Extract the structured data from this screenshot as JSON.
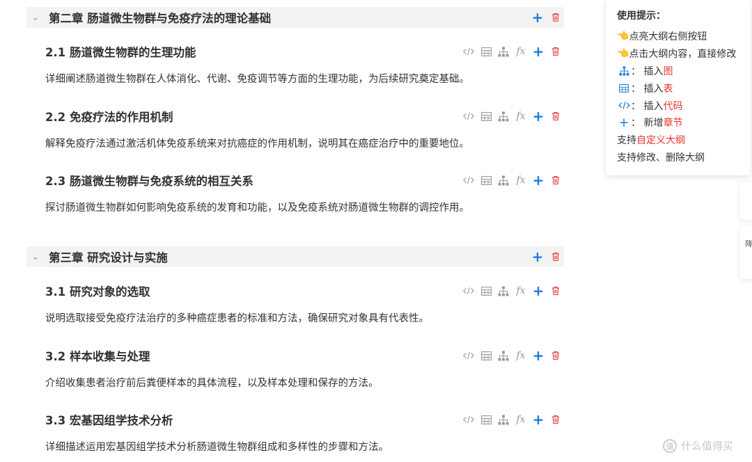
{
  "chapters": [
    {
      "title": "第二章 肠道微生物群与免疫疗法的理论基础",
      "sections": [
        {
          "title": "2.1 肠道微生物群的生理功能",
          "desc": "详细阐述肠道微生物群在人体消化、代谢、免疫调节等方面的生理功能，为后续研究奠定基础。"
        },
        {
          "title": "2.2 免疫疗法的作用机制",
          "desc": "解释免疫疗法通过激活机体免疫系统来对抗癌症的作用机制，说明其在癌症治疗中的重要地位。"
        },
        {
          "title": "2.3 肠道微生物群与免疫系统的相互关系",
          "desc": "探讨肠道微生物群如何影响免疫系统的发育和功能，以及免疫系统对肠道微生物群的调控作用。"
        }
      ]
    },
    {
      "title": "第三章 研究设计与实施",
      "sections": [
        {
          "title": "3.1 研究对象的选取",
          "desc": "说明选取接受免疫疗法治疗的多种癌症患者的标准和方法，确保研究对象具有代表性。"
        },
        {
          "title": "3.2 样本收集与处理",
          "desc": "介绍收集患者治疗前后粪便样本的具体流程，以及样本处理和保存的方法。"
        },
        {
          "title": "3.3 宏基因组学技术分析",
          "desc": "详细描述运用宏基因组学技术分析肠道微生物群组成和多样性的步骤和方法。"
        }
      ]
    }
  ],
  "icons": {
    "code": "</>",
    "fx": "fx",
    "plus": "+"
  },
  "tips": {
    "title": "使用提示：",
    "line1": "点亮大纲右侧按钮",
    "line2": "点击大纲内容，直接修改",
    "insert_prefix": "插入",
    "line3_highlight": "图",
    "line4_highlight": "表",
    "line5_highlight": "代码",
    "new_prefix": "新增",
    "line6_highlight": "章节",
    "support_prefix": "支持",
    "line7_highlight": "自定义大纲",
    "line8": "支持修改、删除大纲",
    "colon": "："
  },
  "edge": {
    "text": "降"
  },
  "watermark": {
    "logo": "值",
    "text": "什么值得买"
  },
  "colors": {
    "accent": "#1a7ce0",
    "danger": "#e8322f",
    "chapter_bg": "#f3f3f3"
  }
}
